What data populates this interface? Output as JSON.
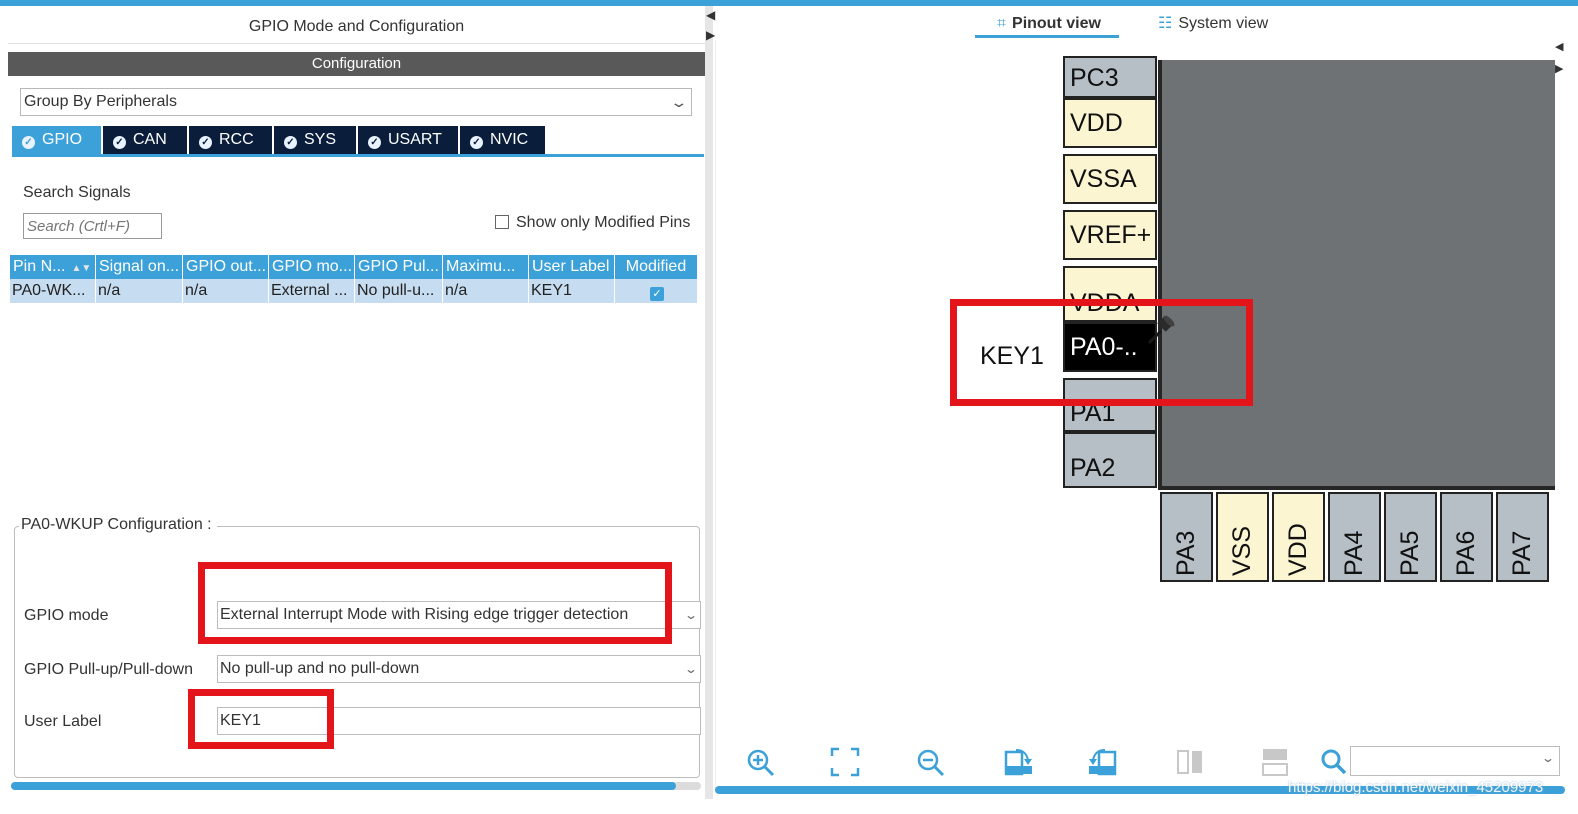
{
  "left_panel": {
    "title": "GPIO Mode and Configuration",
    "config_header": "Configuration",
    "group_by": "Group By Peripherals",
    "tabs": [
      {
        "label": "GPIO",
        "active": true
      },
      {
        "label": "CAN",
        "active": false
      },
      {
        "label": "RCC",
        "active": false
      },
      {
        "label": "SYS",
        "active": false
      },
      {
        "label": "USART",
        "active": false
      },
      {
        "label": "NVIC",
        "active": false
      }
    ],
    "search_label": "Search Signals",
    "search_placeholder": "Search (Crtl+F)",
    "show_modified_label": "Show only Modified Pins",
    "table": {
      "headers": [
        "Pin N...",
        "Signal on...",
        "GPIO out...",
        "GPIO mo...",
        "GPIO Pul...",
        "Maximu...",
        "User Label",
        "Modified"
      ],
      "rows": [
        [
          "PA0-WK...",
          "n/a",
          "n/a",
          "External ...",
          "No pull-u...",
          "n/a",
          "KEY1",
          "checked"
        ]
      ]
    },
    "pin_config_title": "PA0-WKUP Configuration :",
    "fields": {
      "gpio_mode_label": "GPIO mode",
      "gpio_mode_value": "External Interrupt Mode with Rising edge trigger detection",
      "pull_label": "GPIO Pull-up/Pull-down",
      "pull_value": "No pull-up and no pull-down",
      "user_label_label": "User Label",
      "user_label_value": "KEY1"
    }
  },
  "right_panel": {
    "tabs": [
      {
        "label": "Pinout view",
        "icon": "chip-icon",
        "active": true
      },
      {
        "label": "System view",
        "icon": "grid-icon",
        "active": false
      }
    ],
    "left_pins": [
      "PC3",
      "VDD",
      "VSSA",
      "VREF+",
      "VDDA",
      "PA0-..",
      "PA1",
      "PA2"
    ],
    "bottom_pins": [
      "PA3",
      "VSS",
      "VDD",
      "PA4",
      "PA5",
      "PA6",
      "PA7"
    ],
    "pin_label": "KEY1",
    "watermark": "https://blog.csdn.net/weixin_45209973"
  },
  "colors": {
    "accent": "#3ca1d9",
    "tab_dark": "#0a1e3c",
    "highlight_red": "#e3141a",
    "pin_grey": "#b6bec6",
    "pin_yellow": "#fbf5d2"
  }
}
